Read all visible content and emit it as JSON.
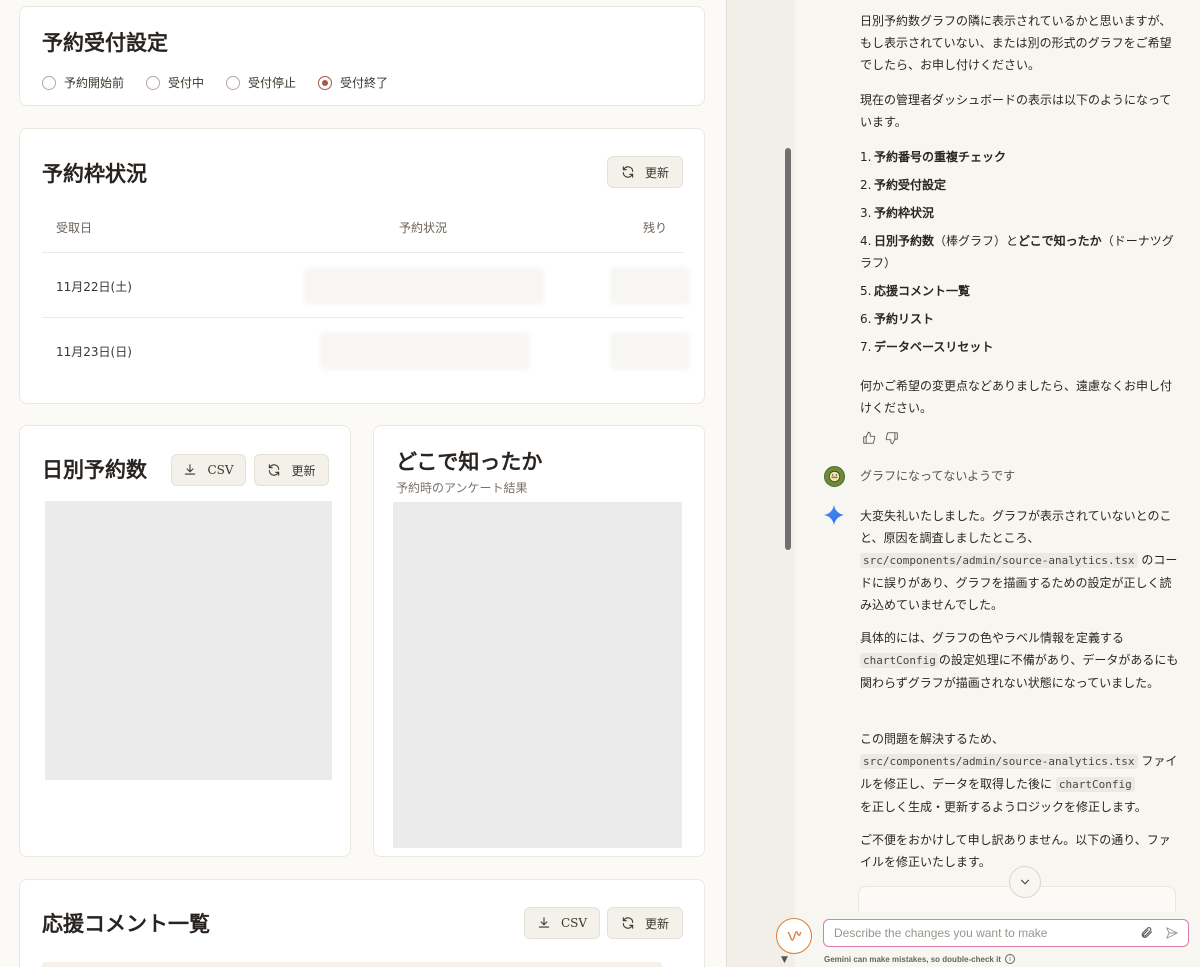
{
  "reception": {
    "title": "予約受付設定",
    "options": [
      "予約開始前",
      "受付中",
      "受付停止",
      "受付終了"
    ],
    "selected": "受付終了"
  },
  "slots": {
    "title": "予約枠状況",
    "refresh_label": "更新",
    "columns": [
      "受取日",
      "予約状況",
      "残り"
    ],
    "rows": [
      {
        "date": "11月22日(土)"
      },
      {
        "date": "11月23日(日)"
      }
    ]
  },
  "daily": {
    "title": "日別予約数",
    "csv_label": "CSV",
    "refresh_label": "更新"
  },
  "source": {
    "title": "どこで知ったか",
    "subtitle": "予約時のアンケート結果"
  },
  "comments": {
    "title": "応援コメント一覧",
    "csv_label": "CSV",
    "refresh_label": "更新"
  },
  "chat": {
    "intro": "日別予約数グラフの隣に表示されているかと思いますが、もし表示されていない、または別の形式のグラフをご希望でしたら、お申し付けください。",
    "current_layout": "現在の管理者ダッシュボードの表示は以下のようになっています。",
    "list": [
      {
        "num": "1.",
        "bold": "予約番号の重複チェック",
        "rest": ""
      },
      {
        "num": "2.",
        "bold": "予約受付設定",
        "rest": ""
      },
      {
        "num": "3.",
        "bold": "予約枠状況",
        "rest": ""
      },
      {
        "num": "4.",
        "bold": "日別予約数",
        "mid": "（棒グラフ）と",
        "bold2": "どこで知ったか",
        "rest": "（ドーナツグラフ）"
      },
      {
        "num": "5.",
        "bold": "応援コメント一覧",
        "rest": ""
      },
      {
        "num": "6.",
        "bold": "予約リスト",
        "rest": ""
      },
      {
        "num": "7.",
        "bold": "データベースリセット",
        "rest": ""
      }
    ],
    "closing": "何かご希望の変更点などありましたら、遠慮なくお申し付けください。",
    "user_message": "グラフになってないようです",
    "reply": {
      "p1_a": "大変失礼いたしました。グラフが表示されていないとのこと、原因を調査しましたところ、",
      "p1_code": "src/components/admin/source-analytics.tsx",
      "p1_b": "のコードに誤りがあり、グラフを描画するための設定が正しく読み込めていませんでした。",
      "p2_a": "具体的には、グラフの色やラベル情報を定義する",
      "p2_code": "chartConfig",
      "p2_b": "の設定処理に不備があり、データがあるにも関わらずグラフが描画されない状態になっていました。",
      "p3_a": "この問題を解決するため、",
      "p3_code1": "src/components/admin/source-analytics.tsx",
      "p3_b": "ファイルを修正し、データを取得した後に",
      "p3_code2": "chartConfig",
      "p3_c": "を正しく生成・更新するようロジックを修正します。",
      "p4": "ご不便をおかけして申し訳ありません。以下の通り、ファイルを修正いたします。"
    },
    "input_placeholder": "Describe the changes you want to make",
    "disclaimer": "Gemini can make mistakes, so double-check it"
  }
}
